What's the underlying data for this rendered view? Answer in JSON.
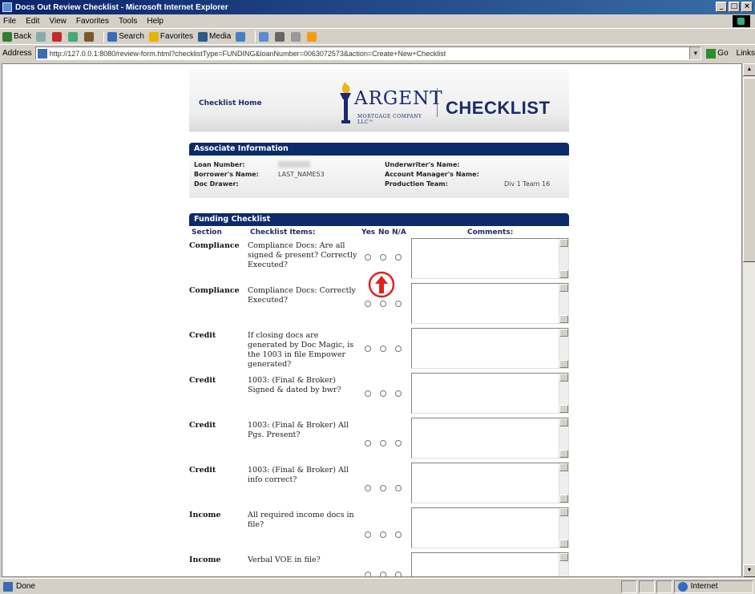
{
  "window": {
    "title": "Docs Out Review Checklist - Microsoft Internet Explorer",
    "controls": [
      "_",
      "□",
      "×"
    ]
  },
  "menu": [
    "File",
    "Edit",
    "View",
    "Favorites",
    "Tools",
    "Help"
  ],
  "toolbar": {
    "back": "Back",
    "search": "Search",
    "favorites": "Favorites",
    "media": "Media"
  },
  "address": {
    "label": "Address",
    "url": "http://127.0.0.1:8080/review-form.html?checklistType=FUNDING&loanNumber=0063072573&action=Create+New+Checklist",
    "go": "Go",
    "links": "Links"
  },
  "status": {
    "text": "Done",
    "zone": "Internet"
  },
  "header": {
    "home_link": "Checklist Home",
    "logo_name": "ARGENT",
    "logo_sub": "MORTGAGE COMPANY LLC™",
    "title": "CHECKLIST"
  },
  "associate": {
    "heading": "Associate Information",
    "loan_number_label": "Loan Number:",
    "borrower_label": "Borrower's Name:",
    "borrower_value": "LAST_NAME53",
    "doc_drawer_label": "Doc Drawer:",
    "underwriter_label": "Underwriter's Name:",
    "account_manager_label": "Account Manager's Name:",
    "production_team_label": "Production Team:",
    "production_team_value": "Div 1 Team 16"
  },
  "funding": {
    "heading": "Funding Checklist",
    "col_section": "Section",
    "col_items": "Checklist Items:",
    "col_yes": "Yes",
    "col_no": "No",
    "col_na": "N/A",
    "col_comments": "Comments:",
    "rows": [
      {
        "section": "Compliance",
        "item": "Compliance Docs: Are all signed & present? Correctly Executed?"
      },
      {
        "section": "Compliance",
        "item": "Compliance Docs: Correctly Executed?"
      },
      {
        "section": "Credit",
        "item": "If closing docs are generated by Doc Magic, is the 1003 in file Empower generated?"
      },
      {
        "section": "Credit",
        "item": "1003: (Final & Broker) Signed & dated by bwr?"
      },
      {
        "section": "Credit",
        "item": "1003: (Final & Broker) All Pgs. Present?"
      },
      {
        "section": "Credit",
        "item": "1003: (Final & Broker) All info correct?"
      },
      {
        "section": "Income",
        "item": "All required income docs in file?"
      },
      {
        "section": "Income",
        "item": "Verbal VOE in file?"
      }
    ]
  },
  "colors": {
    "section_bar": "#0d2a6b",
    "brand": "#1b2a6e",
    "annotation": "#e0211b"
  }
}
